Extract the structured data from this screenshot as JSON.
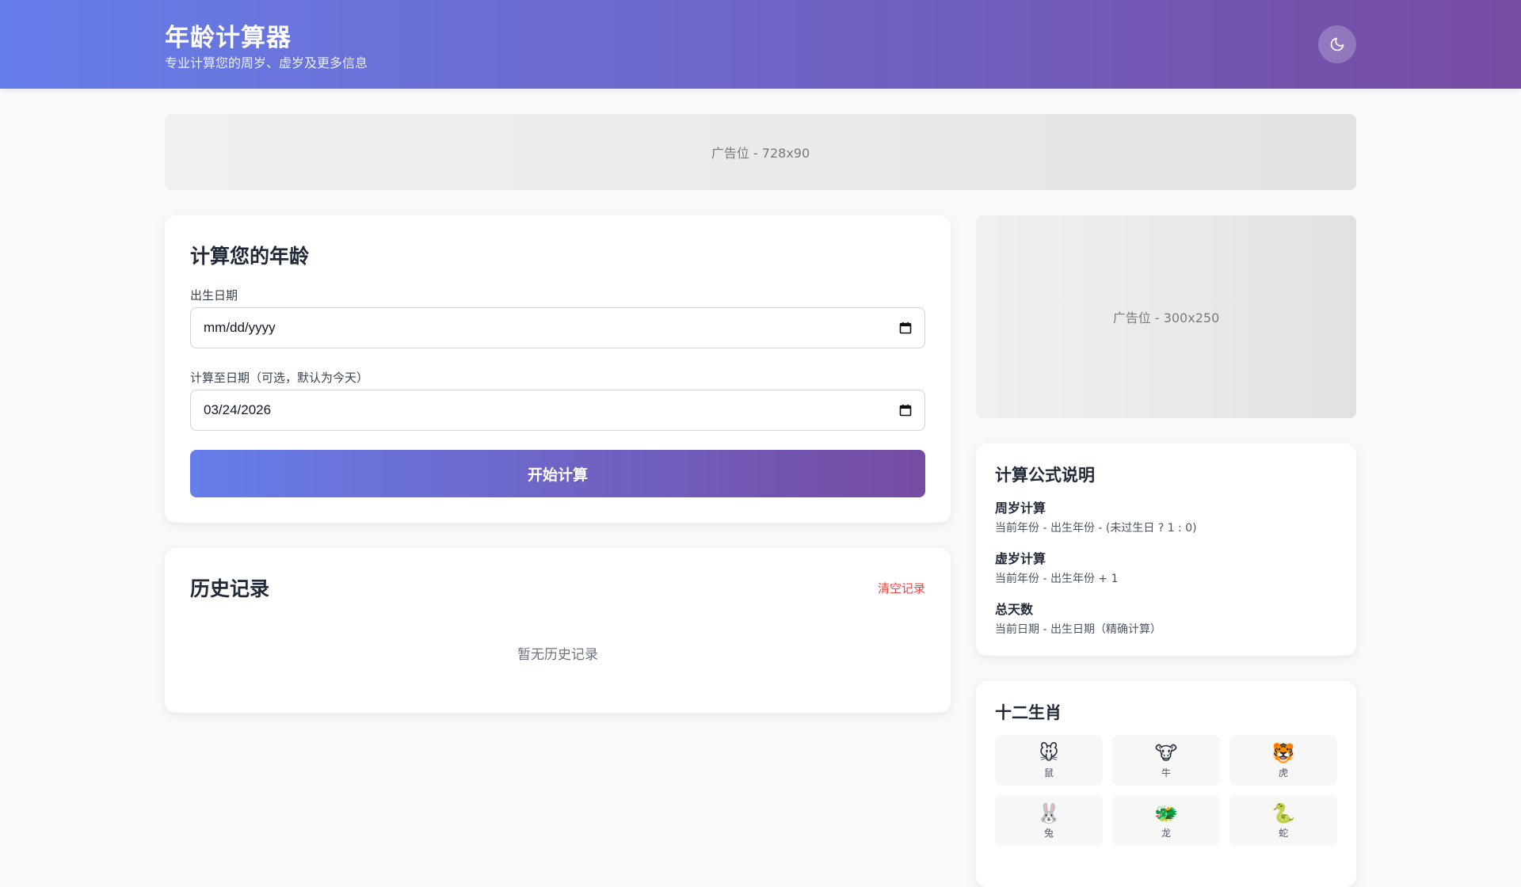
{
  "header": {
    "title": "年龄计算器",
    "subtitle": "专业计算您的周岁、虚岁及更多信息",
    "theme_icon": "moon-icon",
    "gradient_start": "#667eea",
    "gradient_end": "#764ba2"
  },
  "ads": {
    "top": "广告位 - 728x90",
    "side": "广告位 - 300x250"
  },
  "calculator": {
    "title": "计算您的年龄",
    "birth_label": "出生日期",
    "birth_value": "mm/dd/yyyy",
    "target_label": "计算至日期（可选，默认为今天）",
    "target_value": "03/24/2026",
    "submit_label": "开始计算"
  },
  "history": {
    "title": "历史记录",
    "clear_label": "清空记录",
    "empty_text": "暂无历史记录",
    "clear_color": "#ef4444"
  },
  "formulas": {
    "title": "计算公式说明",
    "items": [
      {
        "name": "周岁计算",
        "desc": "当前年份 - 出生年份 - (未过生日 ? 1 : 0)"
      },
      {
        "name": "虚岁计算",
        "desc": "当前年份 - 出生年份 + 1"
      },
      {
        "name": "总天数",
        "desc": "当前日期 - 出生日期（精确计算）"
      }
    ]
  },
  "zodiac": {
    "title": "十二生肖",
    "items": [
      {
        "emoji": "🐭",
        "name": "鼠"
      },
      {
        "emoji": "🐮",
        "name": "牛"
      },
      {
        "emoji": "🐯",
        "name": "虎"
      },
      {
        "emoji": "🐰",
        "name": "兔"
      },
      {
        "emoji": "🐲",
        "name": "龙"
      },
      {
        "emoji": "🐍",
        "name": "蛇"
      }
    ]
  }
}
